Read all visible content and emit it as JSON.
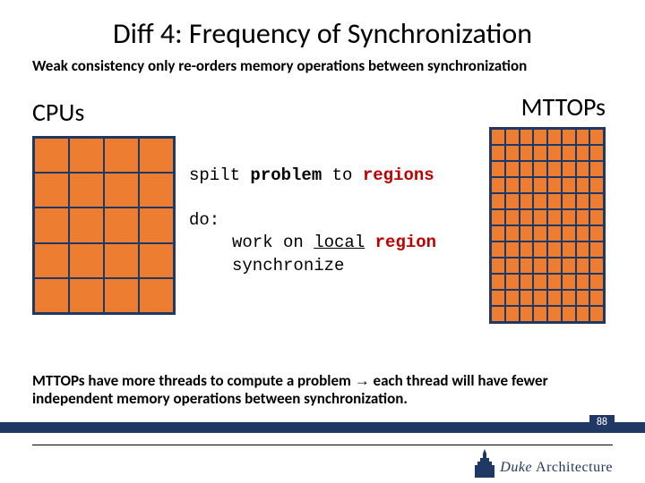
{
  "title": "Diff 4: Frequency of Synchronization",
  "subtitle": "Weak consistency only re-orders memory operations between synchronization",
  "labels": {
    "cpus": "CPUs",
    "mttops": "MTTOPs"
  },
  "code": {
    "line1_a": "spilt ",
    "line1_problem": "problem",
    "line1_b": " to ",
    "line1_regions": "regions",
    "line2": "do:",
    "line3_a": "work on ",
    "line3_local": "local",
    "line3_b": " ",
    "line3_region": "region",
    "line4": "synchronize"
  },
  "bottom_a": "MTTOPs have more threads to compute a problem ",
  "bottom_arrow": "→",
  "bottom_b": " each thread will have fewer independent memory operations between synchronization.",
  "page": "88",
  "logo": {
    "duke": "Duke",
    "arch": "Architecture"
  },
  "grids": {
    "cpu_cells": 20,
    "mttops_cells": 96
  }
}
